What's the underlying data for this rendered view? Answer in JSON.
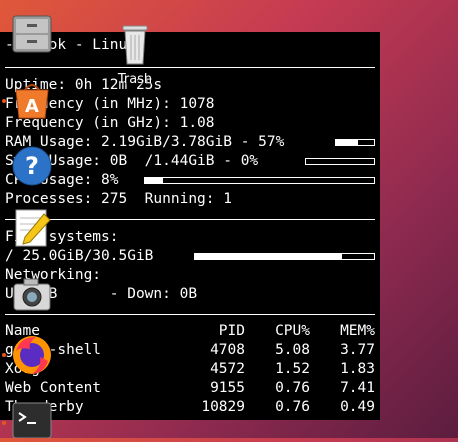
{
  "conky": {
    "title": "- . ook - Linux",
    "uptime": "Uptime: 0h 12m 25s",
    "freq_mhz": "Frequency (in MHz): 1078",
    "freq_ghz": "Frequency (in GHz): 1.08",
    "ram": "RAM Usage: 2.19GiB/3.78GiB - 57%",
    "ram_fraction": 0.57,
    "swap": "Swap Usage: 0B  /1.44GiB - 0%",
    "swap_fraction": 0.0,
    "cpu": "CPU Usage: 8%",
    "cpu_fraction": 0.08,
    "processes": "Processes: 275  Running: 1",
    "fs_header": "File systems:",
    "fs_root": "/ 25.0GiB/30.5GiB",
    "fs_fraction": 0.82,
    "net_header": "Networking:",
    "net": "Up: 0B      - Down: 0B",
    "table_headers": {
      "name": "Name",
      "pid": "PID",
      "cpu": "CPU%",
      "mem": "MEM%"
    },
    "processes_list": [
      {
        "name": "gnome-shell",
        "pid": "4708",
        "cpu": "5.08",
        "mem": "3.77"
      },
      {
        "name": "Xorg",
        "pid": "4572",
        "cpu": "1.52",
        "mem": "1.83"
      },
      {
        "name": "Web Content",
        "pid": "9155",
        "cpu": "0.76",
        "mem": "7.41"
      },
      {
        "name": "Thunderby",
        "pid": "10829",
        "cpu": "0.76",
        "mem": "0.49"
      }
    ]
  },
  "desktop": {
    "trash_label": "Trash"
  },
  "dock": [
    {
      "name": "files-icon"
    },
    {
      "name": "software-center-icon"
    },
    {
      "name": "help-icon"
    },
    {
      "name": "text-editor-icon"
    },
    {
      "name": "screenshot-icon"
    },
    {
      "name": "firefox-icon"
    },
    {
      "name": "terminal-icon"
    }
  ]
}
